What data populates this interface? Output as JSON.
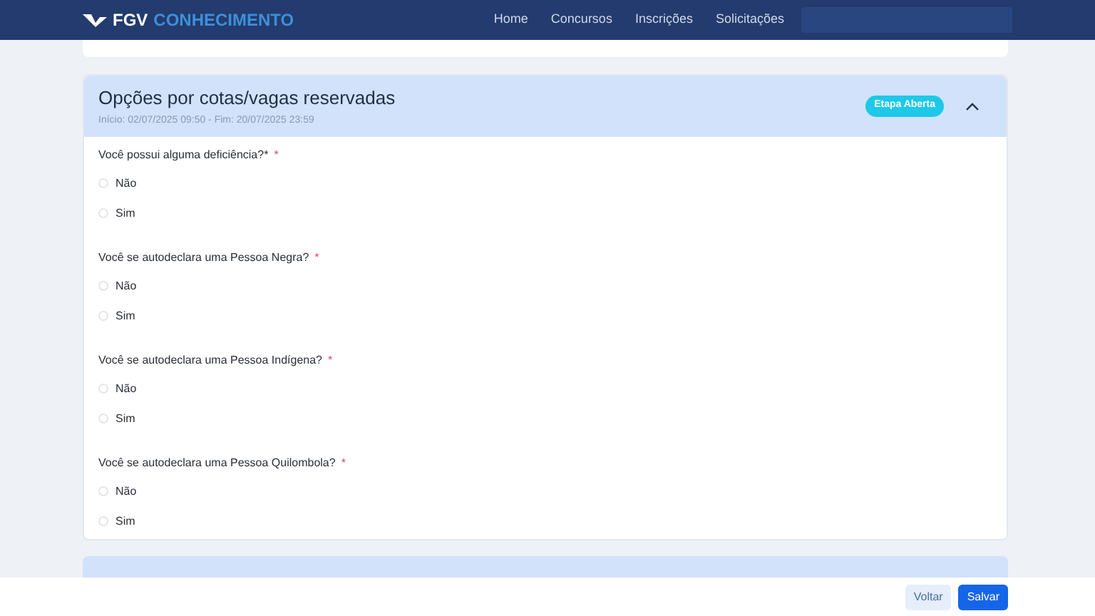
{
  "navbar": {
    "logo": "FGV",
    "brand": "CONHECIMENTO",
    "links": [
      "Home",
      "Concursos",
      "Inscrições",
      "Solicitações"
    ]
  },
  "section": {
    "title": "Opções por cotas/vagas reservadas",
    "dates": "Início: 02/07/2025 09:50 - Fim: 20/07/2025 23:59",
    "badge": "Etapa Aberta",
    "expanded": true,
    "questions": [
      {
        "label": "Você possui alguma deficiência?*",
        "required_mark": "*",
        "options": [
          {
            "label": "Não",
            "selected": false
          },
          {
            "label": "Sim",
            "selected": false
          }
        ]
      },
      {
        "label": "Você se autodeclara uma Pessoa Negra?",
        "required_mark": "*",
        "options": [
          {
            "label": "Não",
            "selected": false
          },
          {
            "label": "Sim",
            "selected": false
          }
        ]
      },
      {
        "label": "Você se autodeclara uma Pessoa Indígena?",
        "required_mark": "*",
        "options": [
          {
            "label": "Não",
            "selected": false
          },
          {
            "label": "Sim",
            "selected": false
          }
        ]
      },
      {
        "label": "Você se autodeclara uma Pessoa Quilombola?",
        "required_mark": "*",
        "options": [
          {
            "label": "Não",
            "selected": false
          },
          {
            "label": "Sim",
            "selected": false
          }
        ]
      }
    ]
  },
  "footer": {
    "buttons": [
      "Voltar",
      "Salvar"
    ]
  }
}
